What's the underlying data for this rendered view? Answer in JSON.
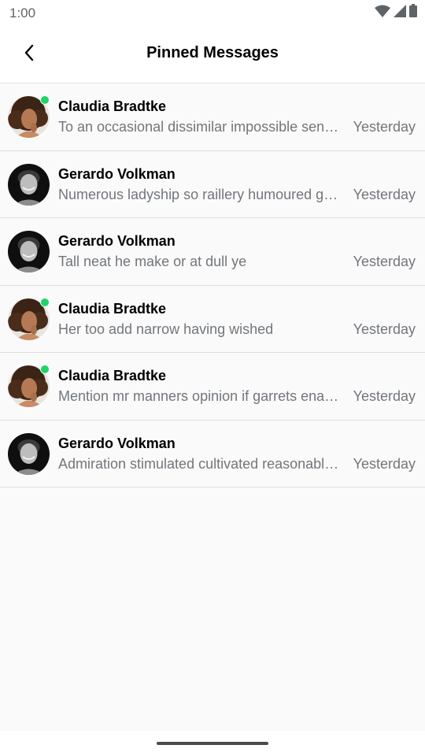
{
  "status_bar": {
    "time": "1:00",
    "icons": [
      "wifi-icon",
      "cellular-signal-icon",
      "battery-icon"
    ]
  },
  "app_bar": {
    "title": "Pinned Messages",
    "back_icon": "chevron-left-icon"
  },
  "messages": [
    {
      "sender": "Claudia Bradtke",
      "preview": "To an occasional dissimilar impossible sentiments.",
      "time": "Yesterday",
      "online": true,
      "avatar": "female-curly-hair-avatar"
    },
    {
      "sender": "Gerardo Volkman",
      "preview": "Numerous ladyship so raillery humoured goodness.",
      "time": "Yesterday",
      "online": false,
      "avatar": "male-avatar"
    },
    {
      "sender": "Gerardo Volkman",
      "preview": "Tall neat he make or at dull ye",
      "time": "Yesterday",
      "online": false,
      "avatar": "male-avatar"
    },
    {
      "sender": "Claudia Bradtke",
      "preview": "Her too add narrow having wished",
      "time": "Yesterday",
      "online": true,
      "avatar": "female-curly-hair-avatar"
    },
    {
      "sender": "Claudia Bradtke",
      "preview": "Mention mr manners opinion if garrets enabled.",
      "time": "Yesterday",
      "online": true,
      "avatar": "female-curly-hair-avatar"
    },
    {
      "sender": "Gerardo Volkman",
      "preview": "Admiration stimulated cultivated reasonable be projection.",
      "time": "Yesterday",
      "online": false,
      "avatar": "male-avatar"
    }
  ],
  "colors": {
    "online": "#20d568",
    "secondary_text": "#72767b",
    "divider": "#dedede",
    "background": "#fafafa"
  }
}
